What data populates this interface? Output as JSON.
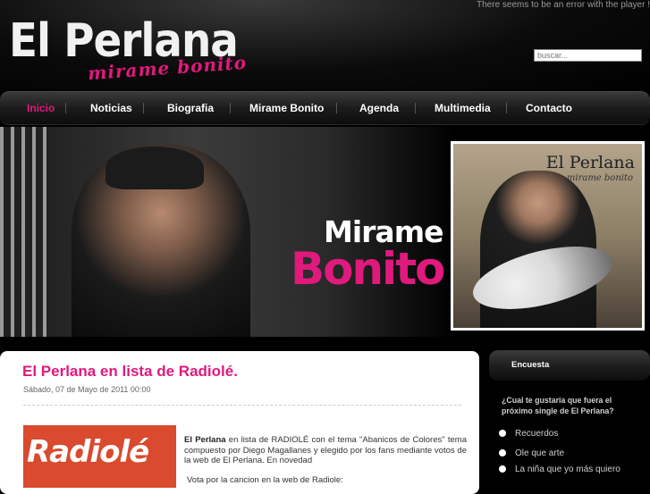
{
  "header": {
    "player_error": "There seems to be an error with the player !",
    "logo_title": "El Perlana",
    "logo_subtitle": "mirame bonito",
    "search_placeholder": "buscar..."
  },
  "nav": {
    "items": [
      {
        "label": "Inicio",
        "active": true
      },
      {
        "label": "Noticias"
      },
      {
        "label": "Biografia"
      },
      {
        "label": "Mirame Bonito"
      },
      {
        "label": "Agenda"
      },
      {
        "label": "Multimedia"
      },
      {
        "label": "Contacto"
      }
    ]
  },
  "banner": {
    "line1": "Mirame",
    "line2": "Bonito",
    "cover_title": "El Perlana",
    "cover_subtitle": "mirame bonito"
  },
  "article": {
    "title": "El Perlana en lista de Radiolé.",
    "date": "Sábado, 07 de Mayo de 2011 00:00",
    "image_label": "Radiolé",
    "body_bold": "El Perlana",
    "body_text": " en lista de RADIOLÉ con el tema \"Abanicos de Colores\" tema compuesto por Diego Magallanes y elegido por los fans mediante votos de la web de El Perlana. En novedad",
    "footer": "Vota por la cancion en la web de Radiole:"
  },
  "sidebar": {
    "title": "Encuesta",
    "question": "¿Cual te gustaria que fuera el próximo single de El Perlana?",
    "options": [
      "Recuerdos",
      "Ole que arte",
      "La niña que yo más quiero"
    ]
  },
  "colors": {
    "accent": "#e0197d",
    "background": "#000000",
    "radiole_red": "#d94a2e"
  }
}
